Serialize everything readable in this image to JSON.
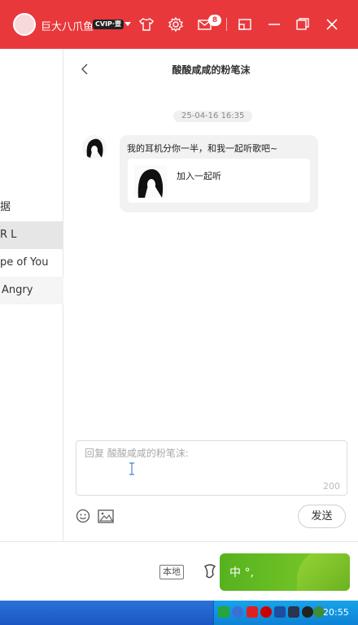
{
  "titlebar": {
    "username": "巨大八爪鱼",
    "vip_label": "CVIP·壹",
    "mail_badge": "8",
    "icons": [
      "tshirt-icon",
      "gear-icon",
      "mail-icon",
      "mini-mode-icon",
      "minimize-icon",
      "maximize-icon",
      "close-icon"
    ]
  },
  "sidebar": {
    "items": [
      {
        "label": "据"
      },
      {
        "label": "R L"
      },
      {
        "label": "pe of You"
      },
      {
        "label": "Angry"
      }
    ]
  },
  "chat": {
    "title": "酸酸咸咸的粉笔沫",
    "timestamp": "25-04-16 16:35",
    "message_text": "我的耳机分你一半，和我一起听歌吧~",
    "card_label": "加入一起听",
    "reply_placeholder": "回复 酸酸咸咸的粉笔沫:",
    "char_count": "200",
    "send_label": "发送"
  },
  "player": {
    "local_label": "本地"
  },
  "ime": {
    "text": "中 °,"
  },
  "taskbar": {
    "clock": "20:55"
  },
  "colors": {
    "brand_red": "#e9383c",
    "taskbar_blue": "#2b71d8",
    "ime_green": "#55b21f"
  }
}
